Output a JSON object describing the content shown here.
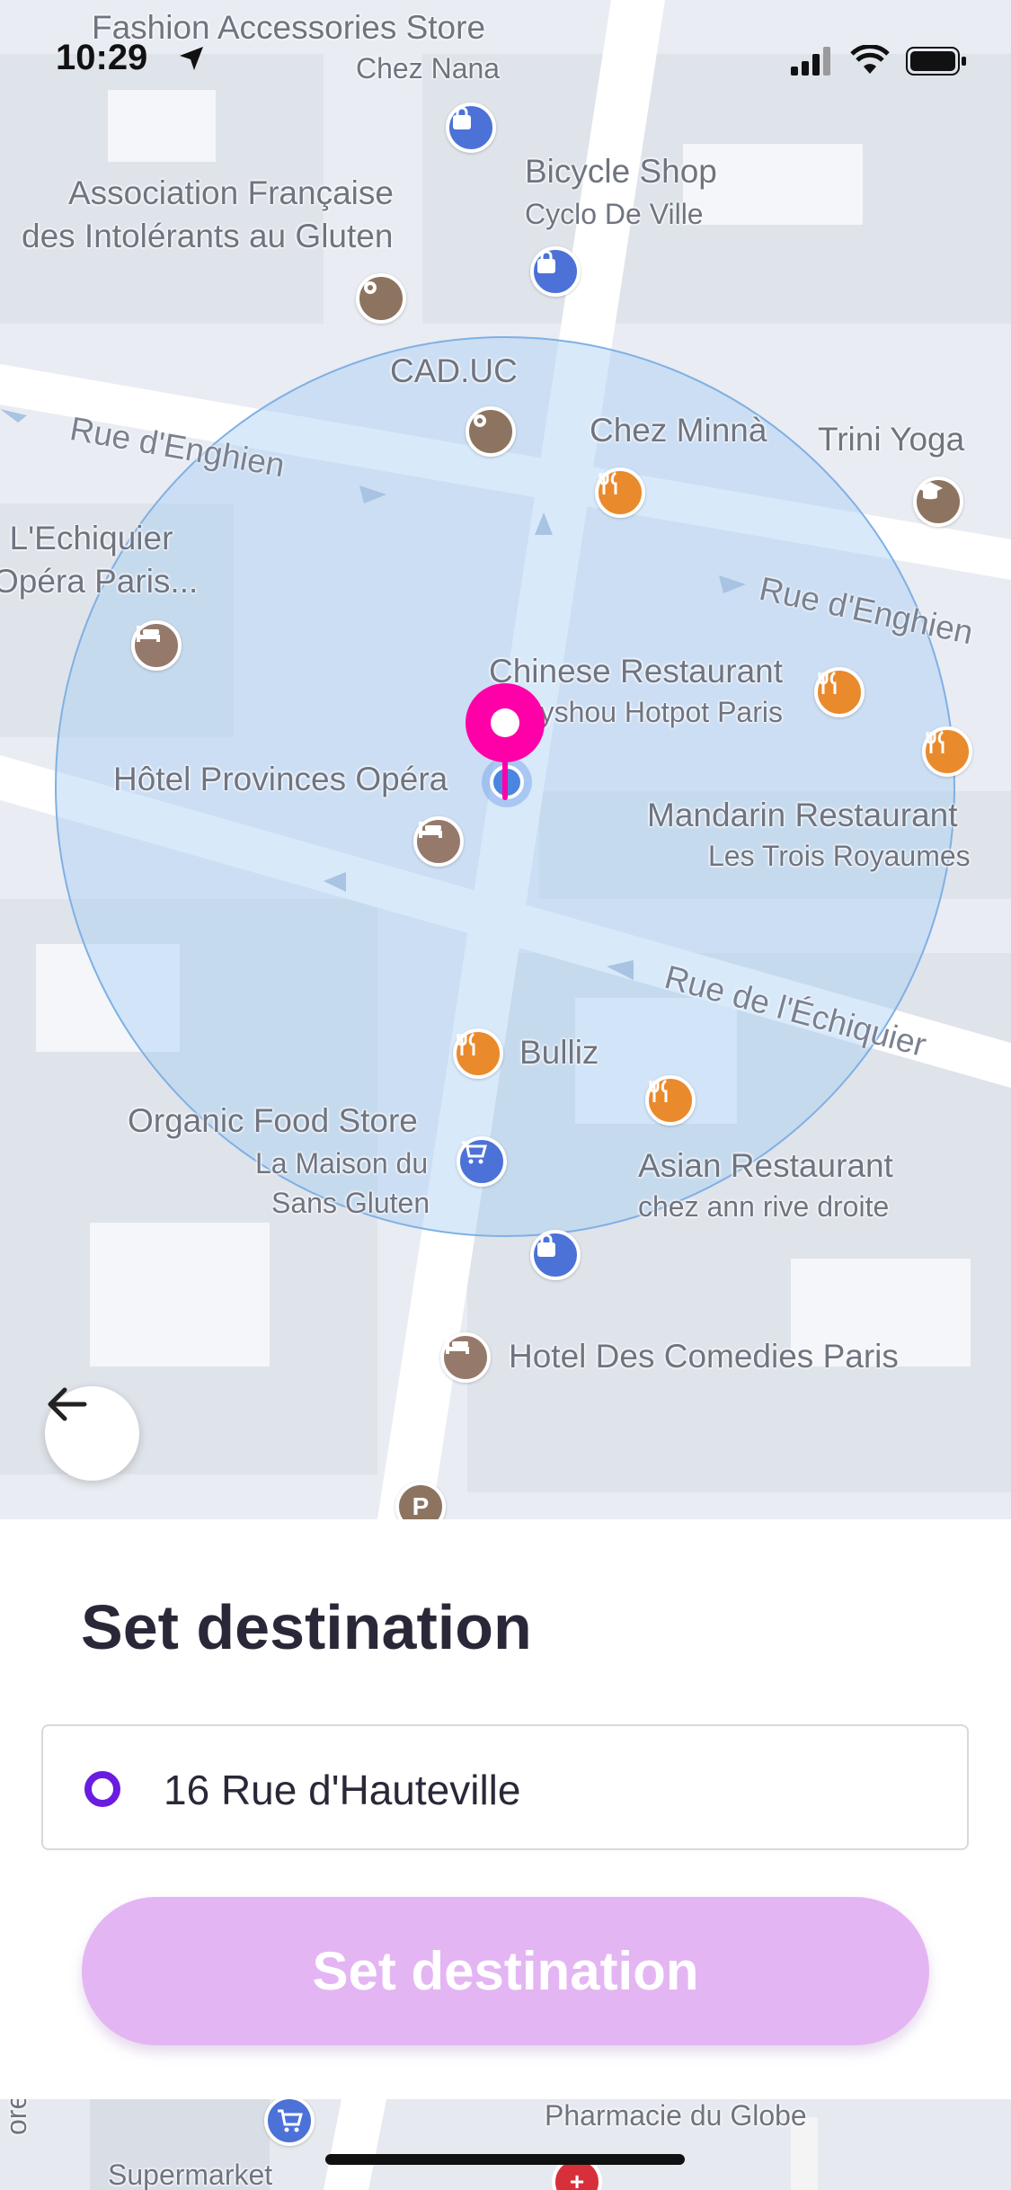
{
  "status_bar": {
    "time": "10:29"
  },
  "map": {
    "places": [
      {
        "name": "Fashion Accessories Store",
        "sub": "Chez Nana"
      },
      {
        "name": "Bicycle Shop",
        "sub": "Cyclo De Ville"
      },
      {
        "name": "Association Française",
        "sub": "des Intolérants au Gluten"
      },
      {
        "name": "CAD.UC"
      },
      {
        "name": "Chez Minnà"
      },
      {
        "name": "Trini Yoga"
      },
      {
        "name": "l L'Echiquier",
        "sub": "Opéra Paris..."
      },
      {
        "name": "Chinese Restaurant",
        "sub": "Lyshou Hotpot Paris"
      },
      {
        "name": "Hôtel Provinces Opéra"
      },
      {
        "name": "Mandarin Restaurant",
        "sub": "Les Trois Royaumes"
      },
      {
        "name": "Bulliz"
      },
      {
        "name": "Organic Food Store",
        "sub": "La Maison du",
        "sub2": "Sans Gluten"
      },
      {
        "name": "Asian Restaurant",
        "sub": "chez ann rive droite"
      },
      {
        "name": "Hotel Des Comedies Paris"
      },
      {
        "name": "Pharmacie du Globe"
      },
      {
        "name": "Supermarket"
      },
      {
        "name": "orel"
      }
    ],
    "streets": {
      "enghien_left": "Rue d'Enghien",
      "enghien_right": "Rue d'Enghien",
      "echiquier": "Rue de l'Échiquier"
    }
  },
  "sheet": {
    "title": "Set destination",
    "destination_value": "16 Rue d'Hauteville",
    "button_label": "Set destination"
  },
  "colors": {
    "accent_pin": "#ff00a8",
    "radio": "#6a1de0",
    "button": "#e4b5f3",
    "title": "#2a2838"
  }
}
